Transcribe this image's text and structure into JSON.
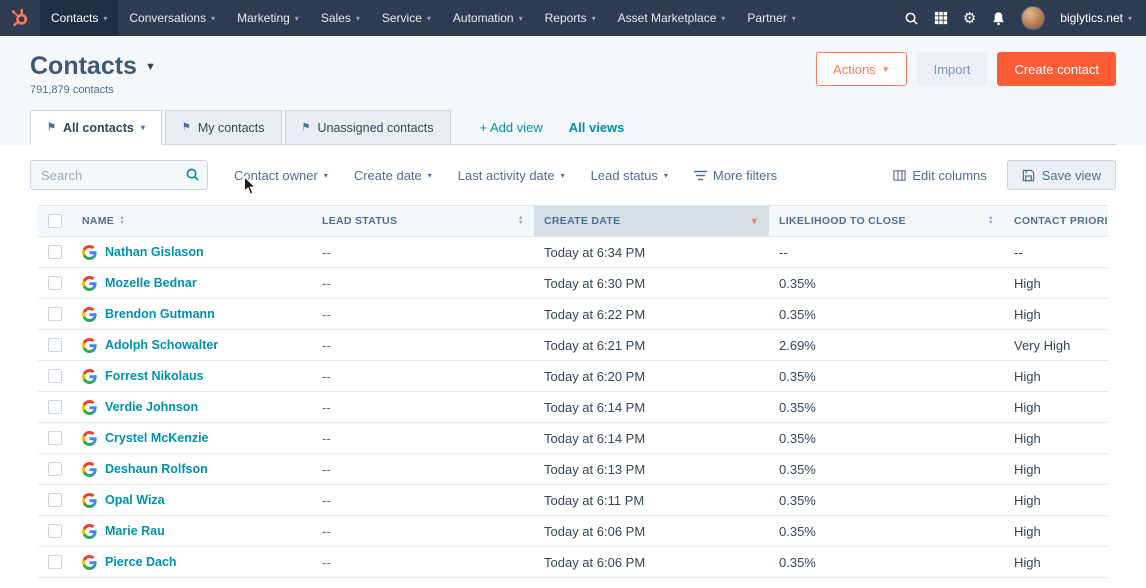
{
  "topnav": {
    "items": [
      {
        "label": "Contacts",
        "active": true
      },
      {
        "label": "Conversations",
        "active": false
      },
      {
        "label": "Marketing",
        "active": false
      },
      {
        "label": "Sales",
        "active": false
      },
      {
        "label": "Service",
        "active": false
      },
      {
        "label": "Automation",
        "active": false
      },
      {
        "label": "Reports",
        "active": false
      },
      {
        "label": "Asset Marketplace",
        "active": false
      },
      {
        "label": "Partner",
        "active": false
      }
    ],
    "icons": [
      "search-icon",
      "marketplace-grid-icon",
      "gear-icon",
      "bell-icon"
    ],
    "account_label": "biglytics.net"
  },
  "header": {
    "title": "Contacts",
    "contact_count": "791,879 contacts",
    "actions_button": "Actions",
    "import_button": "Import",
    "create_button": "Create contact"
  },
  "tabs": {
    "items": [
      "All contacts",
      "My contacts",
      "Unassigned contacts"
    ],
    "add_view": "+ Add view",
    "all_views": "All views"
  },
  "filters": {
    "search_placeholder": "Search",
    "dropdowns": [
      "Contact owner",
      "Create date",
      "Last activity date",
      "Lead status"
    ],
    "more_filters": "More filters",
    "edit_columns": "Edit columns",
    "save_view": "Save view"
  },
  "table": {
    "columns": [
      "NAME",
      "LEAD STATUS",
      "CREATE DATE",
      "LIKELIHOOD TO CLOSE",
      "CONTACT PRIORITY"
    ],
    "sorted_column": "CREATE DATE",
    "sort_direction": "desc",
    "rows": [
      {
        "name": "Nathan Gislason",
        "lead_status": "--",
        "create_date": "Today at 6:34 PM",
        "likelihood": "--",
        "priority": "--"
      },
      {
        "name": "Mozelle Bednar",
        "lead_status": "--",
        "create_date": "Today at 6:30 PM",
        "likelihood": "0.35%",
        "priority": "High"
      },
      {
        "name": "Brendon Gutmann",
        "lead_status": "--",
        "create_date": "Today at 6:22 PM",
        "likelihood": "0.35%",
        "priority": "High"
      },
      {
        "name": "Adolph Schowalter",
        "lead_status": "--",
        "create_date": "Today at 6:21 PM",
        "likelihood": "2.69%",
        "priority": "Very High"
      },
      {
        "name": "Forrest Nikolaus",
        "lead_status": "--",
        "create_date": "Today at 6:20 PM",
        "likelihood": "0.35%",
        "priority": "High"
      },
      {
        "name": "Verdie Johnson",
        "lead_status": "--",
        "create_date": "Today at 6:14 PM",
        "likelihood": "0.35%",
        "priority": "High"
      },
      {
        "name": "Crystel McKenzie",
        "lead_status": "--",
        "create_date": "Today at 6:14 PM",
        "likelihood": "0.35%",
        "priority": "High"
      },
      {
        "name": "Deshaun Rolfson",
        "lead_status": "--",
        "create_date": "Today at 6:13 PM",
        "likelihood": "0.35%",
        "priority": "High"
      },
      {
        "name": "Opal Wiza",
        "lead_status": "--",
        "create_date": "Today at 6:11 PM",
        "likelihood": "0.35%",
        "priority": "High"
      },
      {
        "name": "Marie Rau",
        "lead_status": "--",
        "create_date": "Today at 6:06 PM",
        "likelihood": "0.35%",
        "priority": "High"
      },
      {
        "name": "Pierce Dach",
        "lead_status": "--",
        "create_date": "Today at 6:06 PM",
        "likelihood": "0.35%",
        "priority": "High"
      }
    ]
  },
  "colors": {
    "nav_bg": "#2e3c52",
    "brand_orange": "#ff7a59",
    "create_button_bg": "#ff5c35",
    "link_teal": "#0091ae",
    "sorted_header_bg": "#d6dfe8",
    "header_bg": "#f5f8fa"
  }
}
